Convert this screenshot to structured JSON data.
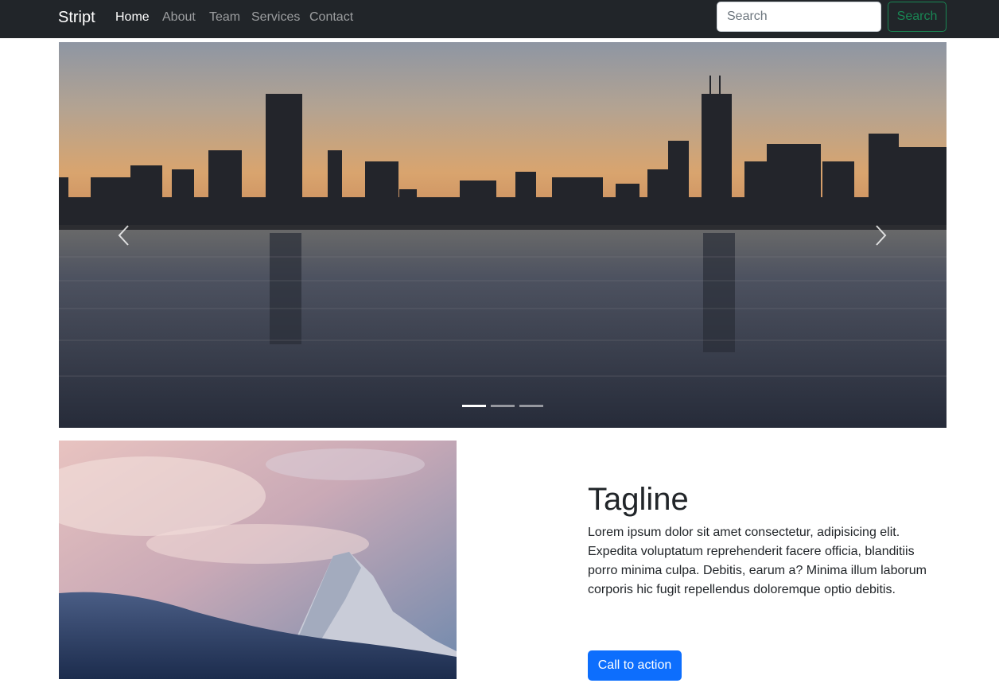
{
  "navbar": {
    "brand": "Stript",
    "links": [
      {
        "label": "Home",
        "active": true
      },
      {
        "label": "About",
        "active": false
      },
      {
        "label": "Team",
        "active": false
      },
      {
        "label": "Services",
        "active": false
      },
      {
        "label": "Contact",
        "active": false
      }
    ],
    "search": {
      "placeholder": "Search",
      "value": "",
      "button_label": "Search"
    }
  },
  "carousel": {
    "slide_count": 3,
    "active_slide": 0,
    "image": "city-skyline-sunset-over-water",
    "prev_icon": "chevron-left-icon",
    "next_icon": "chevron-right-icon"
  },
  "feature": {
    "image": "snowy-mountain-peak-pink-sky",
    "title": "Tagline",
    "body": "Lorem ipsum dolor sit amet consectetur, adipisicing elit. Expedita voluptatum reprehenderit facere officia, blanditiis porro minima culpa. Debitis, earum a? Minima illum laborum corporis hic fugit repellendus doloremque optio debitis.",
    "cta_label": "Call to action"
  },
  "colors": {
    "navbar_bg": "#212529",
    "search_button": "#198754",
    "cta": "#0d6efd"
  }
}
